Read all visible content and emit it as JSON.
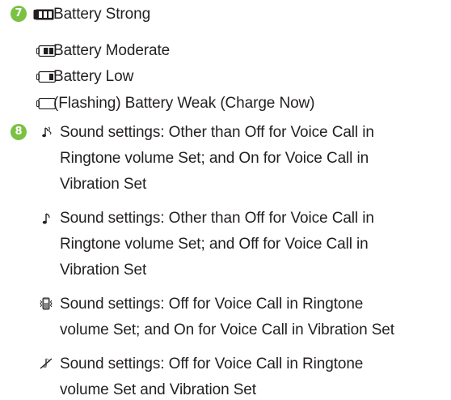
{
  "section7": {
    "number": "7",
    "items": [
      {
        "icon": "battery-strong-icon",
        "text": "Battery Strong"
      },
      {
        "icon": "battery-moderate-icon",
        "text": "Battery Moderate"
      },
      {
        "icon": "battery-low-icon",
        "text": "Battery Low"
      },
      {
        "icon": "battery-weak-icon",
        "text": "(Flashing) Battery Weak (Charge Now)"
      }
    ]
  },
  "section8": {
    "number": "8",
    "items": [
      {
        "icon": "ringtone-vibration-icon",
        "lines": [
          "Sound settings: Other than Off for Voice Call in",
          "Ringtone volume Set; and On for Voice Call in",
          "Vibration Set"
        ]
      },
      {
        "icon": "ringtone-icon",
        "lines": [
          "Sound settings: Other than Off for Voice Call in",
          "Ringtone volume Set; and Off for Voice Call in",
          "Vibration Set"
        ]
      },
      {
        "icon": "vibration-icon",
        "lines": [
          "Sound settings: Off for Voice Call in Ringtone",
          "volume Set; and On for Voice Call in Vibration Set"
        ]
      },
      {
        "icon": "silent-icon",
        "lines": [
          "Sound settings: Off for Voice Call in Ringtone",
          "volume Set and Vibration Set"
        ]
      }
    ]
  },
  "colors": {
    "badge": "#7bc143",
    "text": "#231f20"
  }
}
